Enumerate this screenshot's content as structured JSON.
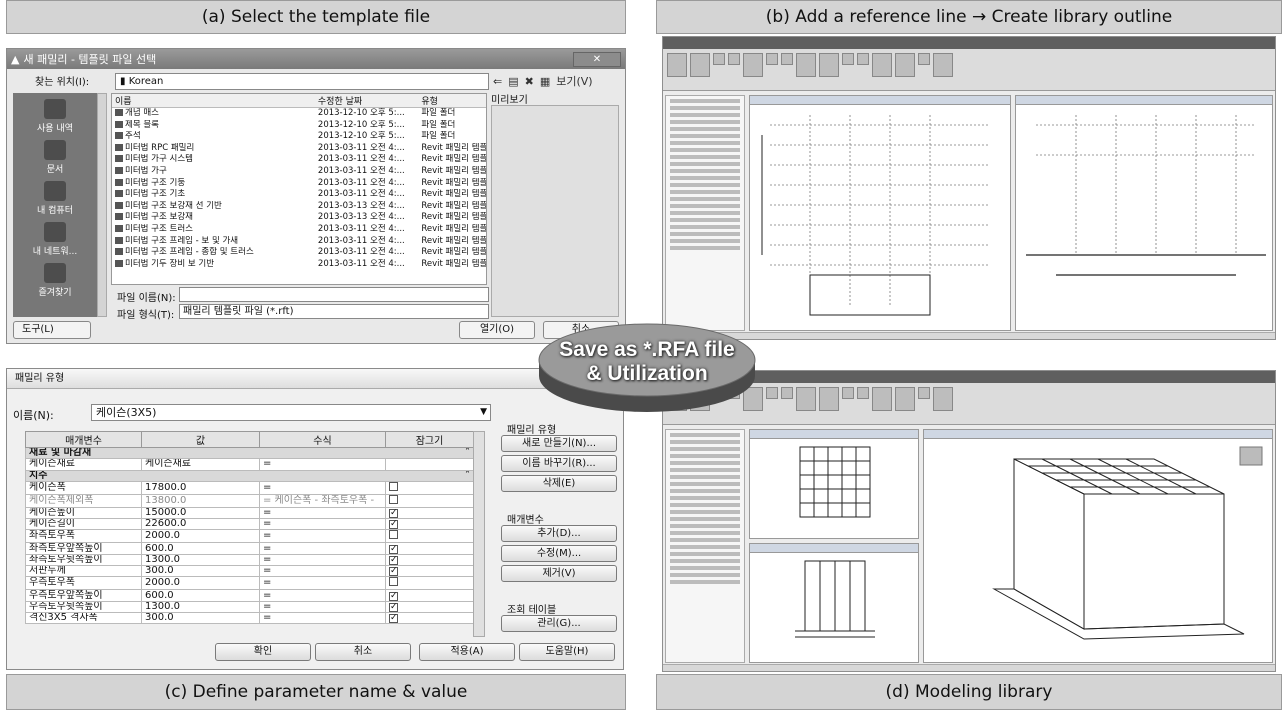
{
  "captions": {
    "a": "(a) Select the template file",
    "b": "(b) Add a reference line → Create library outline",
    "c": "(c) Define parameter name & value",
    "d": "(d) Modeling library"
  },
  "center_label": {
    "line1": "Save as *.RFA file",
    "line2": "& Utilization"
  },
  "open_dialog": {
    "title": "새 패밀리 - 템플릿 파일 선택",
    "look_in_label": "찾는 위치(I):",
    "look_in_value": "Korean",
    "view_menu": "보기(V)",
    "preview_label": "미리보기",
    "places": [
      "사용 내역",
      "문서",
      "내 컴퓨터",
      "내 네트워...",
      "즐겨찾기"
    ],
    "columns": [
      "이름",
      "수정한 날짜",
      "유형"
    ],
    "files": [
      {
        "name": "개념 매스",
        "date": "2013-12-10 오후 5:...",
        "type": "파일 폴더"
      },
      {
        "name": "제목 블록",
        "date": "2013-12-10 오후 5:...",
        "type": "파일 폴더"
      },
      {
        "name": "주석",
        "date": "2013-12-10 오후 5:...",
        "type": "파일 폴더"
      },
      {
        "name": "미터법 RPC 패밀리",
        "date": "2013-03-11 오전 4:...",
        "type": "Revit 패밀리 템플"
      },
      {
        "name": "미터법 가구 시스템",
        "date": "2013-03-11 오전 4:...",
        "type": "Revit 패밀리 템플"
      },
      {
        "name": "미터법 가구",
        "date": "2013-03-11 오전 4:...",
        "type": "Revit 패밀리 템플"
      },
      {
        "name": "미터법 구조 기둥",
        "date": "2013-03-11 오전 4:...",
        "type": "Revit 패밀리 템플"
      },
      {
        "name": "미터법 구조 기초",
        "date": "2013-03-11 오전 4:...",
        "type": "Revit 패밀리 템플"
      },
      {
        "name": "미터법 구조 보강재 선 기반",
        "date": "2013-03-13 오전 4:...",
        "type": "Revit 패밀리 템플"
      },
      {
        "name": "미터법 구조 보강재",
        "date": "2013-03-13 오전 4:...",
        "type": "Revit 패밀리 템플"
      },
      {
        "name": "미터법 구조 트러스",
        "date": "2013-03-11 오전 4:...",
        "type": "Revit 패밀리 템플"
      },
      {
        "name": "미터법 구조 프레임 - 보 및 가새",
        "date": "2013-03-11 오전 4:...",
        "type": "Revit 패밀리 템플"
      },
      {
        "name": "미터법 구조 프레임 - 종합 및 트러스",
        "date": "2013-03-11 오전 4:...",
        "type": "Revit 패밀리 템플"
      },
      {
        "name": "미터법 기두 장비 보 기반",
        "date": "2013-03-11 오전 4:...",
        "type": "Revit 패밀리 템플"
      }
    ],
    "file_name_label": "파일 이름(N):",
    "file_name_value": "",
    "file_type_label": "파일 형식(T):",
    "file_type_value": "패밀리 템플릿 파일 (*.rft)",
    "tools_label": "도구(L)",
    "open_label": "열기(O)",
    "cancel_label": "취소"
  },
  "family_types": {
    "title": "패밀리 유형",
    "name_label": "이름(N):",
    "name_value": "케이슨(3X5)",
    "columns": [
      "매개변수",
      "값",
      "수식",
      "잠그기"
    ],
    "rows": [
      {
        "kind": "group",
        "param": "재료 및 마감재"
      },
      {
        "param": "케이슨재료",
        "value": "케이슨재료",
        "formula": "=",
        "lock": ""
      },
      {
        "kind": "group",
        "param": "치수"
      },
      {
        "param": "케이슨폭",
        "value": "17800.0",
        "formula": "=",
        "lock": "off"
      },
      {
        "param": "케이슨폭제외폭",
        "value": "13800.0",
        "formula": "= 케이슨폭 - 좌측토우폭 -",
        "lock": "off",
        "grey": true
      },
      {
        "param": "케이슨높이",
        "value": "15000.0",
        "formula": "=",
        "lock": "on"
      },
      {
        "param": "케이슨길이",
        "value": "22600.0",
        "formula": "=",
        "lock": "on"
      },
      {
        "param": "좌측토우폭",
        "value": "2000.0",
        "formula": "=",
        "lock": "off"
      },
      {
        "param": "좌측토우앞쪽높이",
        "value": "600.0",
        "formula": "=",
        "lock": "on"
      },
      {
        "param": "좌측토우뒷쪽높이",
        "value": "1300.0",
        "formula": "=",
        "lock": "on"
      },
      {
        "param": "저판두께",
        "value": "300.0",
        "formula": "=",
        "lock": "on"
      },
      {
        "param": "우측토우폭",
        "value": "2000.0",
        "formula": "=",
        "lock": "off"
      },
      {
        "param": "우측토우앞쪽높이",
        "value": "600.0",
        "formula": "=",
        "lock": "on"
      },
      {
        "param": "우측토우뒷쪽높이",
        "value": "1300.0",
        "formula": "=",
        "lock": "on"
      },
      {
        "param": "격신3X5 격자폭",
        "value": "300.0",
        "formula": "=",
        "lock": "on"
      }
    ],
    "family_type_label": "패밀리 유형",
    "new_btn": "새로 만들기(N)...",
    "rename_btn": "이름 바꾸기(R)...",
    "delete_btn": "삭제(E)",
    "params_label": "매개변수",
    "add_btn": "추가(D)...",
    "modify_btn": "수정(M)...",
    "remove_btn": "제거(V)",
    "lookup_label": "조회 테이블",
    "manage_btn": "관리(G)...",
    "ok_btn": "확인",
    "cancel_btn": "취소",
    "apply_btn": "적용(A)",
    "help_btn": "도움말(H)"
  },
  "colors": {
    "caption_bg": "#d4d4d4",
    "ellipse_top": "#9a9a9a",
    "ellipse_side": "#4a4a4a"
  }
}
